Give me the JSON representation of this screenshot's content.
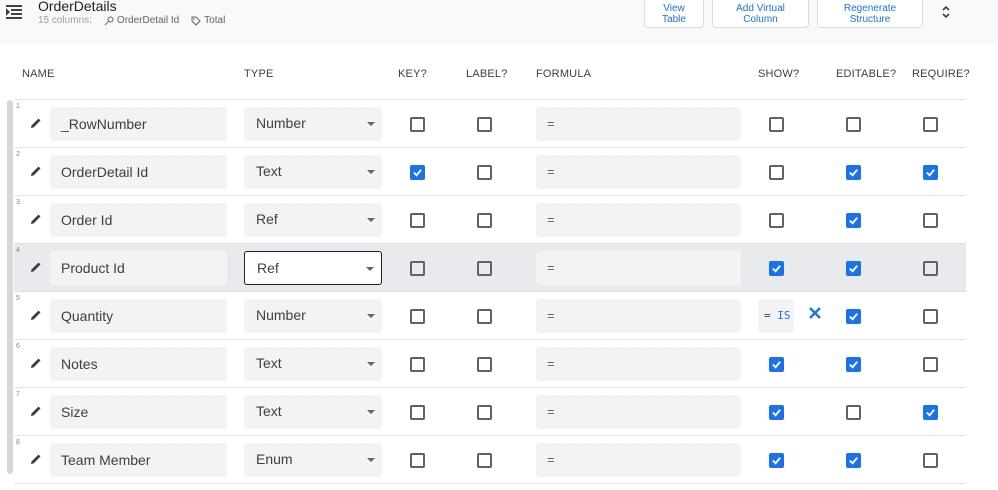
{
  "header": {
    "table_name": "OrderDetails",
    "column_count": "15 columns:",
    "key_chip": "OrderDetail Id",
    "label_chip": "Total",
    "buttons": {
      "view_table": "View Table",
      "add_virtual": "Add Virtual Column",
      "regenerate": "Regenerate Structure"
    }
  },
  "columns_header": {
    "name": "NAME",
    "type": "TYPE",
    "key": "KEY?",
    "label": "LABEL?",
    "formula": "FORMULA",
    "show": "SHOW?",
    "editable": "EDITABLE?",
    "require": "REQUIRE?"
  },
  "rows": [
    {
      "num": "1",
      "name": "_RowNumber",
      "type": "Number",
      "formula": "=",
      "key": false,
      "label": false,
      "show": false,
      "editable": false,
      "require": false
    },
    {
      "num": "2",
      "name": "OrderDetail Id",
      "type": "Text",
      "formula": "=",
      "key": true,
      "label": false,
      "show": false,
      "editable": true,
      "require": true
    },
    {
      "num": "3",
      "name": "Order Id",
      "type": "Ref",
      "formula": "=",
      "key": false,
      "label": false,
      "show": false,
      "editable": true,
      "require": false
    },
    {
      "num": "4",
      "name": "Product Id",
      "type": "Ref",
      "formula": "=",
      "key": false,
      "label": false,
      "show": true,
      "editable": true,
      "require": false
    },
    {
      "num": "5",
      "name": "Quantity",
      "type": "Number",
      "formula": "=",
      "key": false,
      "label": false,
      "show_expression": {
        "eq": "=",
        "fn": "IS"
      },
      "editable": true,
      "require": false
    },
    {
      "num": "6",
      "name": "Notes",
      "type": "Text",
      "formula": "=",
      "key": false,
      "label": false,
      "show": true,
      "editable": true,
      "require": false
    },
    {
      "num": "7",
      "name": "Size",
      "type": "Text",
      "formula": "=",
      "key": false,
      "label": false,
      "show": true,
      "editable": false,
      "require": true
    },
    {
      "num": "8",
      "name": "Team Member",
      "type": "Enum",
      "formula": "=",
      "key": false,
      "label": false,
      "show": true,
      "editable": true,
      "require": false
    }
  ],
  "colors": {
    "accent": "#1a73e8",
    "checkbox_border": "#5f6368",
    "field_bg": "#f1f3f4",
    "highlight_row": "#e8eaed"
  },
  "icons": [
    "menu-icon",
    "key-icon",
    "tag-icon",
    "unfold-icon",
    "pencil-icon",
    "check-icon",
    "close-icon",
    "dropdown-arrow-icon"
  ]
}
